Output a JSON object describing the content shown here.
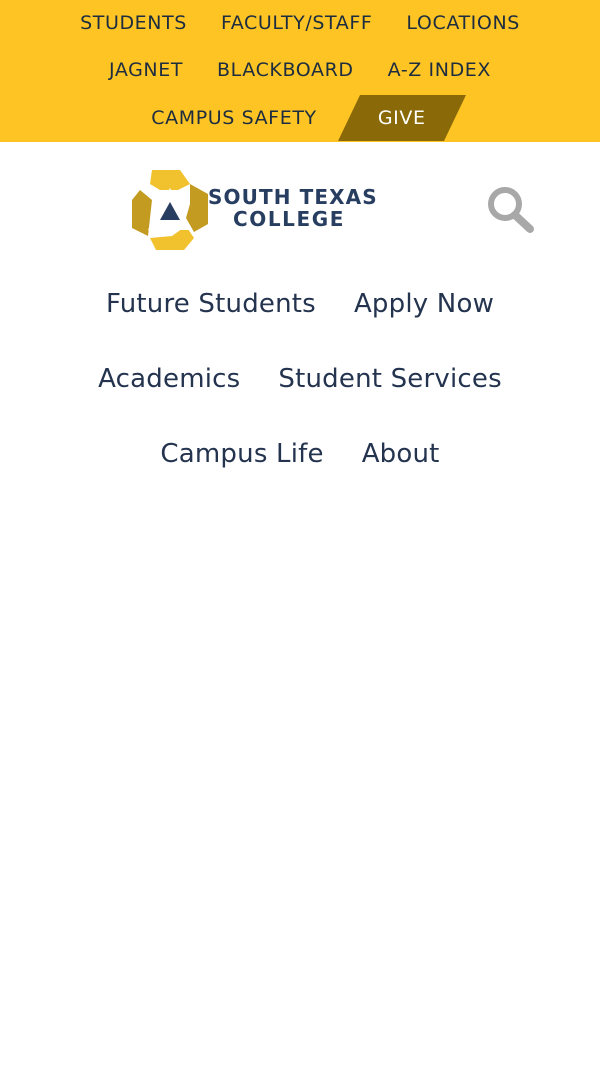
{
  "utility_nav": {
    "students": "STUDENTS",
    "faculty_staff": "FACULTY/STAFF",
    "locations": "LOCATIONS",
    "jagnet": "JAGNET",
    "blackboard": "BLACKBOARD",
    "az_index": "A-Z INDEX",
    "campus_safety": "CAMPUS SAFETY",
    "give": "GIVE"
  },
  "logo": {
    "line1": "SOUTH TEXAS",
    "line2": "COLLEGE",
    "icon": "stc-triangle-logo-icon"
  },
  "search": {
    "icon": "search-icon"
  },
  "main_nav": {
    "future_students": "Future Students",
    "apply_now": "Apply Now",
    "academics": "Academics",
    "student_services": "Student Services",
    "campus_life": "Campus Life",
    "about": "About"
  },
  "colors": {
    "utility_bar_bg": "#fdc424",
    "give_bg": "#8a6a08",
    "text_dark": "#1d2d3f",
    "navy": "#283e61",
    "logo_gold": "#c29b20",
    "logo_yellow": "#f2c12e",
    "search_gray": "#a8a8a8"
  }
}
